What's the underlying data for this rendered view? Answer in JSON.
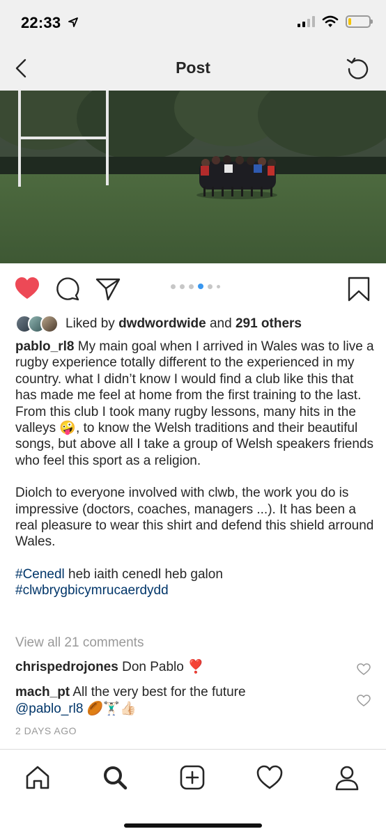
{
  "status_bar": {
    "time": "22:33",
    "battery_level": 0.15,
    "battery_color": "#f5c500"
  },
  "nav": {
    "title": "Post",
    "back_icon": "chevron-left-icon",
    "right_icon": "refresh-icon"
  },
  "actions": {
    "liked": true,
    "like_color": "#ed4956",
    "carousel_dots": 6,
    "carousel_active_index": 3
  },
  "likes": {
    "prefix": "Liked by",
    "user": "dwdwordwide",
    "joiner": "and",
    "others": "291 others"
  },
  "caption": {
    "username": "pablo_rl8",
    "para1": "My main goal when I arrived in Wales was to live a rugby experience totally different to the experienced in my country. what I didn’t know I would find a club like this that has made me feel at home from the first training to the last. From this club I took many rugby lessons, many hits in the valleys 🤪, to know the Welsh traditions and their beautiful songs, but above all I take a group of Welsh speakers friends who feel this sport as a religion.",
    "para2": "Diolch to everyone involved with clwb, the work you do is impressive (doctors, coaches, managers ...). It has been a real pleasure to wear this shirt and defend this shield arround Wales.",
    "hashtag1": "#Cenedl",
    "hashtag1_rest": " heb iaith cenedl heb galon",
    "hashtag2": "#clwbrygbicymrucaerdydd"
  },
  "view_all_comments": "View all 21 comments",
  "comments": [
    {
      "username": "chrispedrojones",
      "text": "Don Pablo ❣️"
    },
    {
      "username": "mach_pt",
      "text": "All the very best for the future",
      "mention": "@pablo_rl8",
      "emojis": "🏉🏋🏻‍♂️👍🏻"
    }
  ],
  "timestamp": "2 DAYS AGO",
  "tab_bar": {
    "items": [
      "home-icon",
      "search-icon",
      "new-post-icon",
      "activity-icon",
      "profile-icon"
    ],
    "active": "search-icon"
  }
}
